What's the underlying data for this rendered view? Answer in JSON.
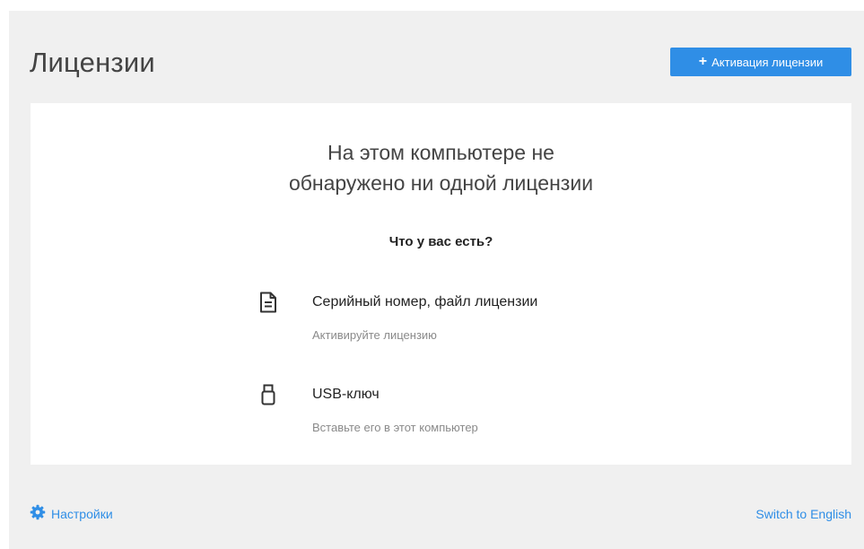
{
  "header": {
    "title": "Лицензии",
    "activate_button": {
      "icon": "plus-icon",
      "label": "Активация лицензии"
    }
  },
  "main": {
    "headline_line1": "На этом компьютере не",
    "headline_line2": "обнаружено ни одной лицензии",
    "question": "Что у вас есть?",
    "options": [
      {
        "icon": "document-icon",
        "title": "Серийный номер, файл лицензии",
        "subtitle": "Активируйте лицензию"
      },
      {
        "icon": "usb-key-icon",
        "title": "USB-ключ",
        "subtitle": "Вставьте его в этот компьютер"
      }
    ]
  },
  "footer": {
    "settings": {
      "icon": "gear-icon",
      "label": "Настройки"
    },
    "language_link": "Switch to English"
  },
  "colors": {
    "accent": "#2f8ee6",
    "background": "#f0f0f0",
    "card": "#ffffff",
    "title_text": "#444444",
    "muted_text": "#8a8a8a"
  }
}
